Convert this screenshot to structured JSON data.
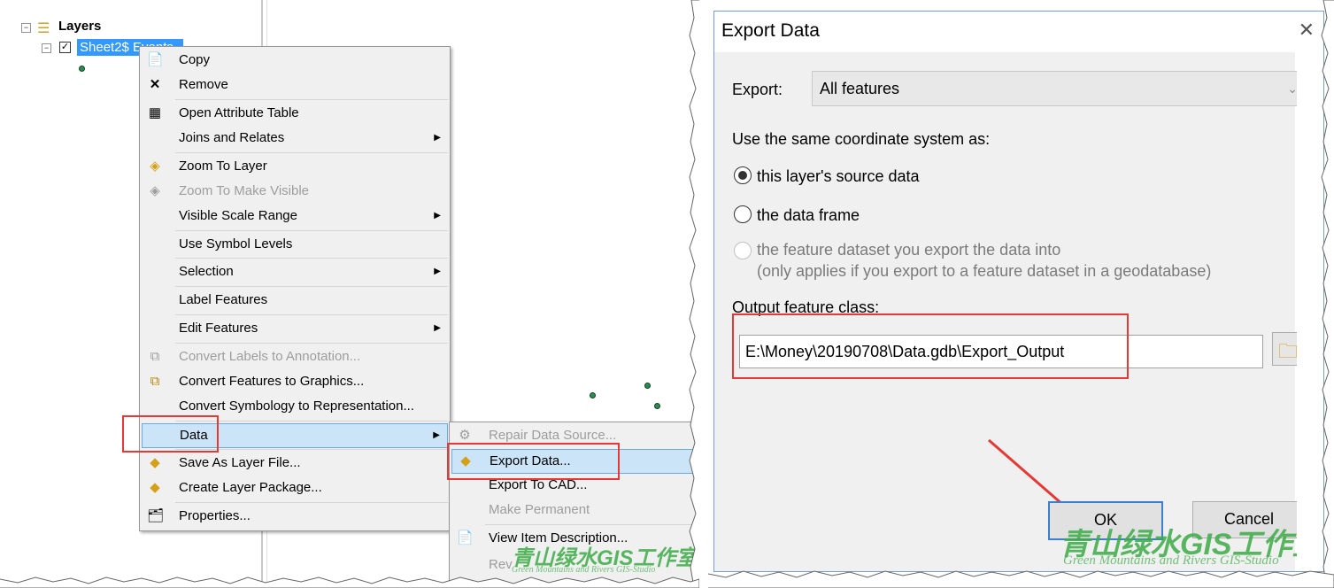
{
  "toc": {
    "root_label": "Layers",
    "layer_label": "Sheet2$ Events"
  },
  "context_menu": {
    "items": [
      {
        "label": "Copy",
        "icon": "copy-icon",
        "enabled": true
      },
      {
        "label": "Remove",
        "icon": "remove-x-icon",
        "enabled": true
      },
      {
        "label": "Open Attribute Table",
        "icon": "table-icon",
        "enabled": true
      },
      {
        "label": "Joins and Relates",
        "submenu": true,
        "enabled": true
      },
      {
        "label": "Zoom To Layer",
        "icon": "zoom-layer-icon",
        "enabled": true
      },
      {
        "label": "Zoom To Make Visible",
        "icon": "zoom-visible-icon",
        "enabled": false
      },
      {
        "label": "Visible Scale Range",
        "submenu": true,
        "enabled": true
      },
      {
        "label": "Use Symbol Levels",
        "enabled": true
      },
      {
        "label": "Selection",
        "submenu": true,
        "enabled": true
      },
      {
        "label": "Label Features",
        "enabled": true
      },
      {
        "label": "Edit Features",
        "submenu": true,
        "enabled": true
      },
      {
        "label": "Convert Labels to Annotation...",
        "icon": "convert-labels-icon",
        "enabled": false
      },
      {
        "label": "Convert Features to Graphics...",
        "icon": "convert-graphics-icon",
        "enabled": true
      },
      {
        "label": "Convert Symbology to Representation...",
        "enabled": true
      },
      {
        "label": "Data",
        "submenu": true,
        "enabled": true,
        "highlighted": true
      },
      {
        "label": "Save As Layer File...",
        "icon": "layer-file-icon",
        "enabled": true
      },
      {
        "label": "Create Layer Package...",
        "icon": "layer-package-icon",
        "enabled": true
      },
      {
        "label": "Properties...",
        "icon": "properties-icon",
        "enabled": true
      }
    ]
  },
  "data_submenu": {
    "items": [
      {
        "label": "Repair Data Source...",
        "icon": "repair-icon",
        "enabled": false
      },
      {
        "label": "Export Data...",
        "icon": "export-data-icon",
        "enabled": true,
        "highlighted": true
      },
      {
        "label": "Export To CAD...",
        "enabled": true
      },
      {
        "label": "Make Permanent",
        "enabled": false
      },
      {
        "label": "View Item Description...",
        "icon": "item-description-icon",
        "enabled": true
      },
      {
        "label": "Rev",
        "enabled": false
      }
    ]
  },
  "dialog": {
    "title": "Export Data",
    "export_label": "Export:",
    "export_value": "All features",
    "coord_label": "Use the same coordinate system as:",
    "radio_source": "this layer's source data",
    "radio_frame": "the data frame",
    "radio_dataset_line1": "the feature dataset you export the data into",
    "radio_dataset_line2": "(only applies if you export to a feature dataset in a geodatabase)",
    "output_label": "Output feature class:",
    "output_value": "E:\\Money\\20190708\\Data.gdb\\Export_Output",
    "ok_label": "OK",
    "cancel_label": "Cancel"
  },
  "watermark": {
    "cn": "青山绿水GIS工作室",
    "en": "Green Mountains and Rivers GIS-Studio"
  },
  "colors": {
    "highlight": "#cce4f7",
    "selection": "#3399ff",
    "annotation_red": "#e53935",
    "watermark_green": "#3caa46"
  }
}
